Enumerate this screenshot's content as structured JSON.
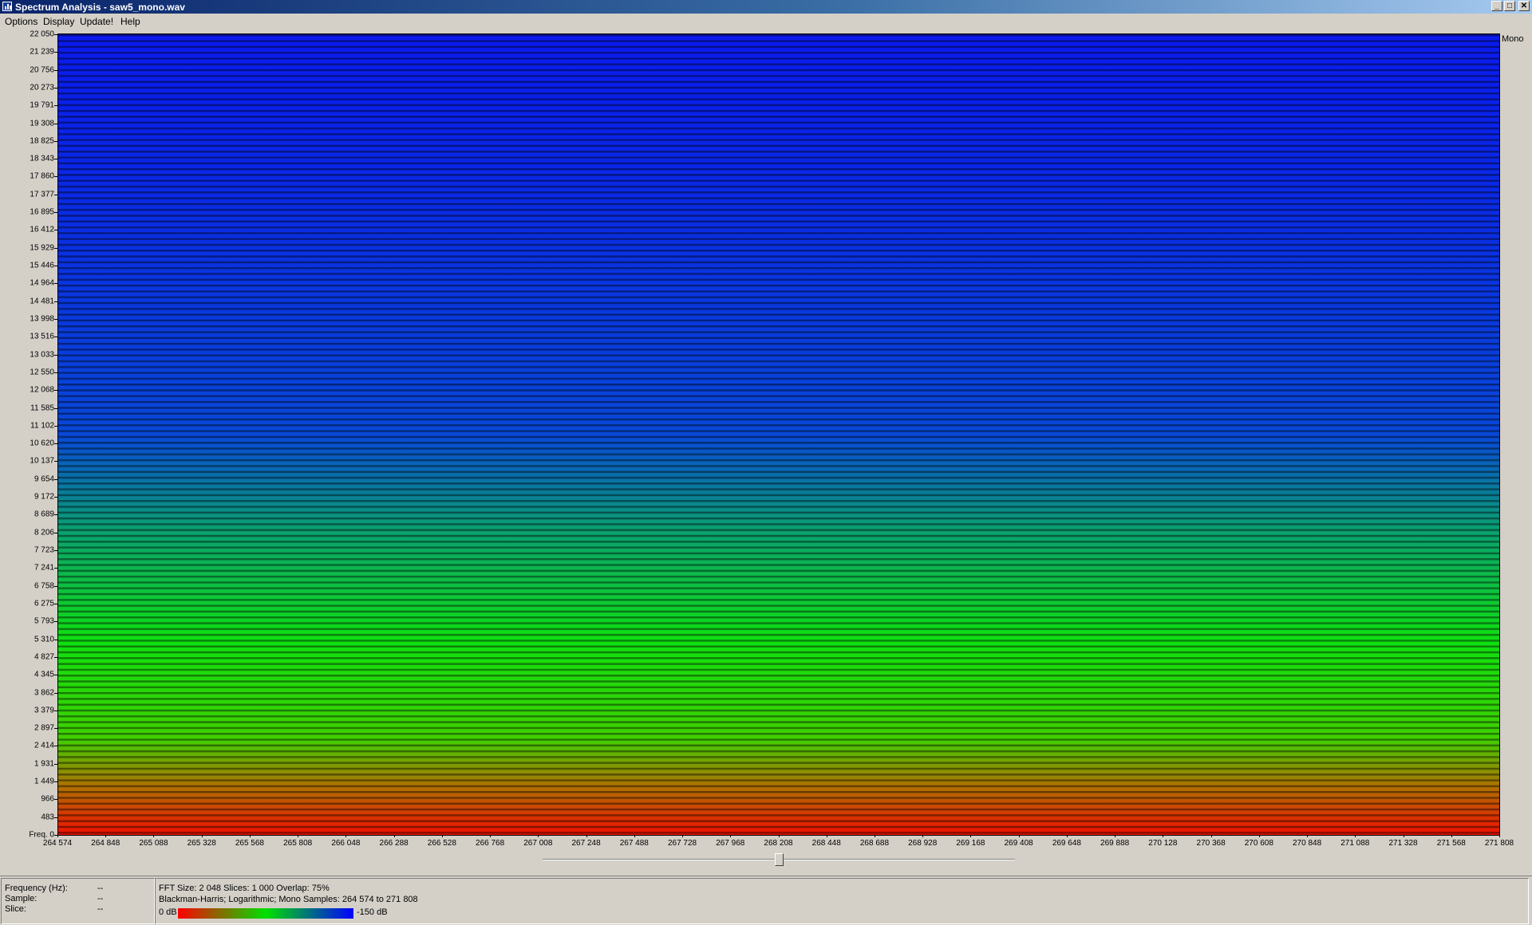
{
  "window": {
    "title": "Spectrum Analysis - saw5_mono.wav",
    "controls": {
      "minimize": "_",
      "restore": "□",
      "close": "✕"
    },
    "icon": "app-icon"
  },
  "menu": [
    "Options",
    "Display",
    "Update!",
    "Help"
  ],
  "spectrogram": {
    "channel_label": "Mono",
    "y_axis_labels": [
      "22 050",
      "21 239",
      "20 756",
      "20 273",
      "19 791",
      "19 308",
      "18 825",
      "18 343",
      "17 860",
      "17 377",
      "16 895",
      "16 412",
      "15 929",
      "15 446",
      "14 964",
      "14 481",
      "13 998",
      "13 516",
      "13 033",
      "12 550",
      "12 068",
      "11 585",
      "11 102",
      "10 620",
      "10 137",
      "9 654",
      "9 172",
      "8 689",
      "8 206",
      "7 723",
      "7 241",
      "6 758",
      "6 275",
      "5 793",
      "5 310",
      "4 827",
      "4 345",
      "3 862",
      "3 379",
      "2 897",
      "2 414",
      "1 931",
      "1 449",
      "966",
      "483",
      "Freq. 0"
    ],
    "x_axis_labels": [
      "264 574",
      "264 848",
      "265 088",
      "265 328",
      "265 568",
      "265 808",
      "266 048",
      "266 288",
      "266 528",
      "266 768",
      "267 008",
      "267 248",
      "267 488",
      "267 728",
      "267 968",
      "268 208",
      "268 448",
      "268 688",
      "268 928",
      "269 168",
      "269 408",
      "269 648",
      "269 888",
      "270 128",
      "270 368",
      "270 608",
      "270 848",
      "271 088",
      "271 328",
      "271 568",
      "271 808"
    ],
    "colors": {
      "loud": "#e02000",
      "mid": "#00e000",
      "quiet": "#0000ff"
    }
  },
  "scroll_position": 0.5,
  "info": {
    "frequency_label": "Frequency (Hz):",
    "frequency_value": "--",
    "sample_label": "Sample:",
    "sample_value": "--",
    "slice_label": "Slice:",
    "slice_value": "--"
  },
  "details": {
    "line1": "FFT Size: 2 048  Slices: 1 000  Overlap: 75%",
    "line2": "Blackman-Harris; Logarithmic; Mono  Samples: 264 574 to 271 808",
    "legend_min": "0 dB",
    "legend_max": "-150 dB"
  }
}
